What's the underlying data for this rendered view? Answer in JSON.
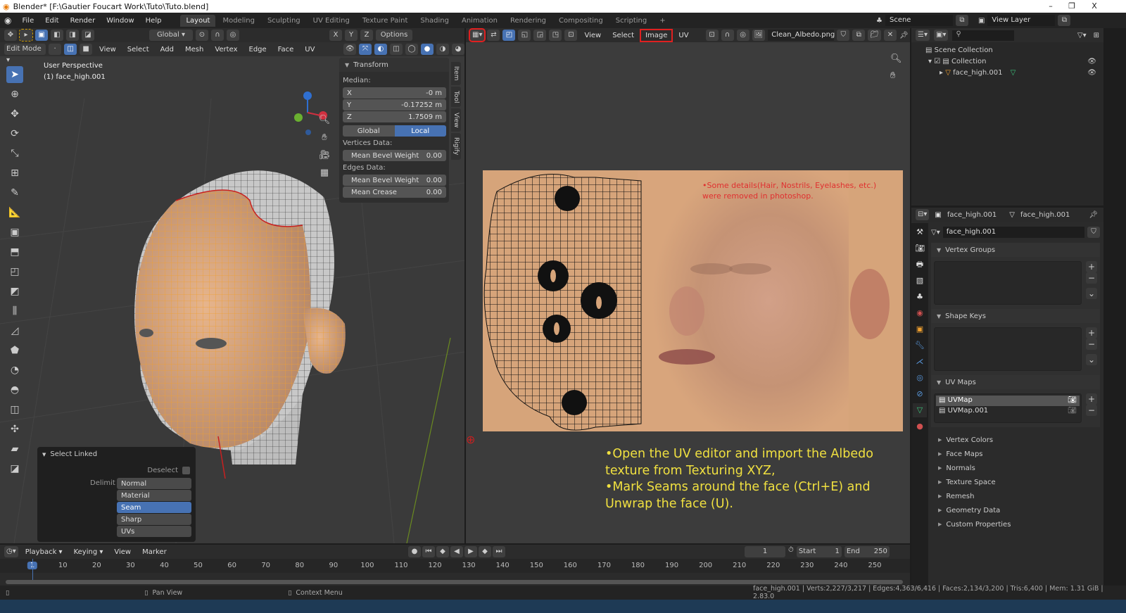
{
  "window": {
    "title": "Blender* [F:\\Gautier Foucart Work\\Tuto\\Tuto.blend]",
    "minimize": "–",
    "restore": "❐",
    "close": "X"
  },
  "menubar": {
    "items": [
      "File",
      "Edit",
      "Render",
      "Window",
      "Help"
    ]
  },
  "workspaces": [
    "Layout",
    "Modeling",
    "Sculpting",
    "UV Editing",
    "Texture Paint",
    "Shading",
    "Animation",
    "Rendering",
    "Compositing",
    "Scripting"
  ],
  "add_workspace": "+",
  "scene": {
    "name": "Scene",
    "view_layer": "View Layer"
  },
  "viewport": {
    "transform_orientation": "Global",
    "axes": [
      "X",
      "Y",
      "Z"
    ],
    "options_label": "Options",
    "mode": "Edit Mode",
    "menus": [
      "View",
      "Select",
      "Add",
      "Mesh",
      "Vertex",
      "Edge",
      "Face",
      "UV"
    ],
    "overlay_title": "User Perspective",
    "overlay_object": "(1) face_high.001",
    "sidebar_tabs": [
      "Item",
      "Tool",
      "View",
      "Rigify"
    ],
    "transform": {
      "title": "Transform",
      "median_label": "Median:",
      "fields": [
        {
          "label": "X",
          "value": "-0 m"
        },
        {
          "label": "Y",
          "value": "-0.17252 m"
        },
        {
          "label": "Z",
          "value": "1.7509 m"
        }
      ],
      "space_options": [
        "Global",
        "Local"
      ],
      "space_selected": "Local",
      "vertices_label": "Vertices Data:",
      "vertices_fields": [
        {
          "label": "Mean Bevel Weight",
          "value": "0.00"
        }
      ],
      "edges_label": "Edges Data:",
      "edges_fields": [
        {
          "label": "Mean Bevel Weight",
          "value": "0.00"
        },
        {
          "label": "Mean Crease",
          "value": "0.00"
        }
      ]
    },
    "select_linked": {
      "title": "Select Linked",
      "deselect_label": "Deselect",
      "delimit_label": "Delimit",
      "options": [
        "Normal",
        "Material",
        "Seam",
        "Sharp",
        "UVs"
      ],
      "selected": "Seam"
    }
  },
  "uv_editor": {
    "menus": [
      "View",
      "Select",
      "Image",
      "UV"
    ],
    "highlighted_menu": "Image",
    "image_name": "Clean_Albedo.png",
    "image_note": "•Some details(Hair, Nostrils, Eyelashes, etc.)\nwere removed in photoshop.",
    "instructions": [
      "•Open the UV editor and import the Albedo",
      "texture from Texturing XYZ,",
      "•Mark Seams around the face (Ctrl+E) and",
      "Unwrap the face (U)."
    ]
  },
  "outliner": {
    "root": "Scene Collection",
    "collection": "Collection",
    "object": "face_high.001"
  },
  "properties": {
    "object_name": "face_high.001",
    "mesh_name": "face_high.001",
    "data_field": "face_high.001",
    "sections_open": [
      "Vertex Groups",
      "Shape Keys",
      "UV Maps"
    ],
    "uv_maps": [
      "UVMap",
      "UVMap.001"
    ],
    "uv_selected": "UVMap",
    "sections_closed": [
      "Vertex Colors",
      "Face Maps",
      "Normals",
      "Texture Space",
      "Remesh",
      "Geometry Data",
      "Custom Properties"
    ]
  },
  "timeline": {
    "menus": [
      "Playback",
      "Keying",
      "View",
      "Marker"
    ],
    "current_frame": "1",
    "start_label": "Start",
    "start": "1",
    "end_label": "End",
    "end": "250",
    "ticks": [
      "1",
      "10",
      "20",
      "30",
      "40",
      "50",
      "60",
      "70",
      "80",
      "90",
      "100",
      "110",
      "120",
      "130",
      "140",
      "150",
      "160",
      "170",
      "180",
      "190",
      "200",
      "210",
      "220",
      "230",
      "240",
      "250"
    ]
  },
  "statusbar": {
    "pan": "Pan View",
    "context": "Context Menu",
    "stats": "face_high.001 | Verts:2,227/3,217 | Edges:4,363/6,416 | Faces:2,134/3,200 | Tris:6,400 | Mem: 1.31 GiB | 2.83.0"
  },
  "colors": {
    "accent": "#4772b3",
    "highlight": "#e02020",
    "selection": "#f0a030",
    "note_text": "#e03030",
    "instruction_text": "#f0e040"
  }
}
